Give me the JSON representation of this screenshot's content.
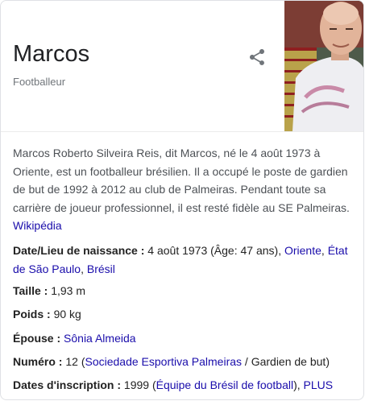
{
  "entity": {
    "title": "Marcos",
    "subtitle": "Footballeur",
    "photo_icon": "person-photo"
  },
  "description": {
    "text": "Marcos Roberto Silveira Reis, dit Marcos, né le 4 août 1973 à Oriente, est un footballeur brésilien. Il a occupé le poste de gardien de but de 1992 à 2012 au club de Palmeiras. Pendant toute sa carrière de joueur professionnel, il est resté fidèle au SE Palmeiras.",
    "source_link": "Wikipédia"
  },
  "facts": {
    "birth": {
      "label": "Date/Lieu de naissance",
      "sep": " : ",
      "value_plain": "4 août 1973 (Âge: 47 ans), ",
      "link1": "Oriente",
      "comma1": ", ",
      "link2": "État de São Paulo",
      "comma2": ", ",
      "link3": "Brésil"
    },
    "height": {
      "label": "Taille",
      "sep": " : ",
      "value": "1,93 m"
    },
    "weight": {
      "label": "Poids",
      "sep": " : ",
      "value": "90 kg"
    },
    "spouse": {
      "label": "Épouse",
      "sep": " : ",
      "link": "Sônia Almeida"
    },
    "number": {
      "label": "Numéro",
      "sep": " : ",
      "value_pre": "12 (",
      "link": "Sociedade Esportiva Palmeiras",
      "value_post": " / Gardien de but)"
    },
    "registration": {
      "label": "Dates d'inscription",
      "sep": " : ",
      "value_pre": "1999 (",
      "link": "Équipe du Brésil de football",
      "value_post": "), ",
      "more_link": "PLUS"
    }
  },
  "colors": {
    "link": "#1a0dab",
    "muted": "#70757a",
    "border": "#dfe1e5"
  }
}
